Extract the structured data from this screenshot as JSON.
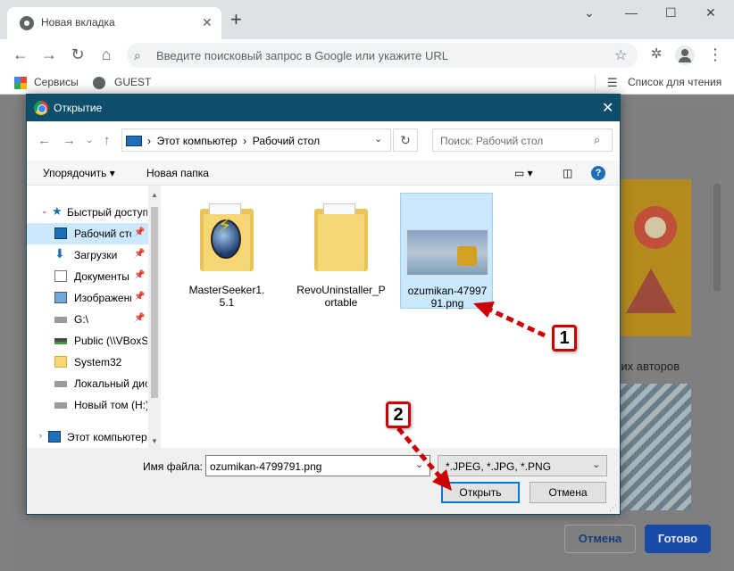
{
  "browser": {
    "tab_title": "Новая вкладка",
    "new_tab_icon": "plus-icon",
    "omnibox_placeholder": "Введите поисковый запрос в Google или укажите URL",
    "bookmarks": [
      {
        "label": "Сервисы",
        "icon": "apps-grid-icon"
      },
      {
        "label": "GUEST",
        "icon": "globe-icon"
      }
    ],
    "reading_list": "Список для чтения"
  },
  "page": {
    "partial_text": "нских авторов",
    "cancel_label": "Отмена",
    "done_label": "Готово"
  },
  "dialog": {
    "title": "Открытие",
    "breadcrumb": [
      "Этот компьютер",
      "Рабочий стол"
    ],
    "search_placeholder": "Поиск: Рабочий стол",
    "organize_label": "Упорядочить",
    "new_folder_label": "Новая папка",
    "tree": [
      {
        "label": "Быстрый доступ",
        "icon": "star-icon",
        "pinned": false
      },
      {
        "label": "Рабочий стол",
        "icon": "desktop-icon",
        "pinned": true,
        "selected": true
      },
      {
        "label": "Загрузки",
        "icon": "download-icon",
        "pinned": true
      },
      {
        "label": "Документы",
        "icon": "documents-icon",
        "pinned": true
      },
      {
        "label": "Изображения",
        "icon": "pictures-icon",
        "pinned": true
      },
      {
        "label": "G:\\",
        "icon": "drive-icon",
        "pinned": true
      },
      {
        "label": "Public (\\\\VBoxSvr)",
        "icon": "network-drive-icon",
        "pinned": false
      },
      {
        "label": "System32",
        "icon": "folder-icon",
        "pinned": false
      },
      {
        "label": "Локальный диск",
        "icon": "drive-icon",
        "pinned": false
      },
      {
        "label": "Новый том (H:)",
        "icon": "drive-icon",
        "pinned": false
      },
      {
        "label": "Этот компьютер",
        "icon": "computer-icon",
        "pinned": false
      }
    ],
    "files": [
      {
        "label": "MasterSeeker1.5.1",
        "icon": "folder-icon"
      },
      {
        "label": "RevoUninstaller_Portable",
        "icon": "folder-icon"
      },
      {
        "label": "ozumikan-4799791.png",
        "icon": "image-thumbnail",
        "selected": true
      }
    ],
    "filename_label": "Имя файла:",
    "filename_value": "ozumikan-4799791.png",
    "filetype_value": "*.JPEG, *.JPG, *.PNG",
    "open_label": "Открыть",
    "cancel_label": "Отмена"
  },
  "annotations": {
    "step1": "1",
    "step2": "2",
    "color": "#cc0000"
  }
}
